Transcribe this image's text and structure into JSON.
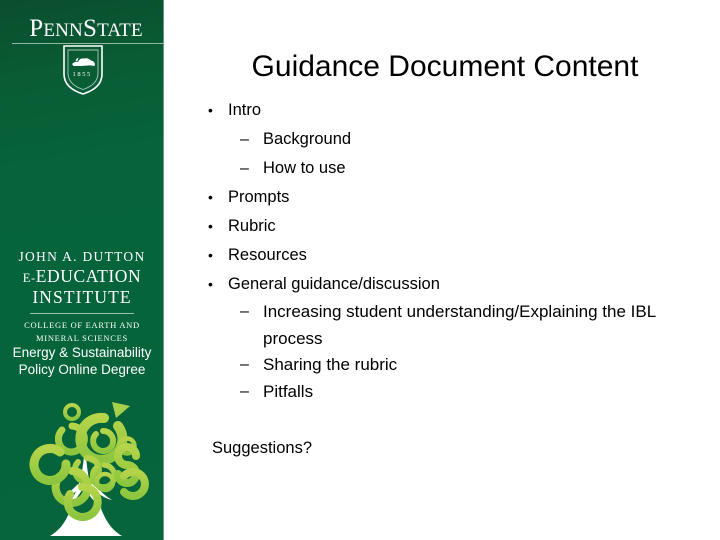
{
  "slide": {
    "title": "Guidance Document Content",
    "closing_text": "Suggestions?",
    "background_color": "#ffffff",
    "text_color": "#000000"
  },
  "sidebar": {
    "background_color": "#06633a",
    "accent_color": "#8dc63f",
    "pennstate_logo": {
      "wordmark_part1": "P",
      "wordmark_part2": "ENN",
      "wordmark_part3": "S",
      "wordmark_part4": "TATE",
      "shield_year": "1855",
      "icon": "pennstate-shield-lion-icon"
    },
    "dutton_logo": {
      "line1": "JOHN A. DUTTON",
      "line2_prefix": "E-",
      "line2": "EDUCATION",
      "line3": "INSTITUTE",
      "sub_line1": "COLLEGE OF EARTH AND",
      "sub_line2": "MINERAL SCIENCES"
    },
    "degree": {
      "line1": "Energy & Sustainability",
      "line2": "Policy Online Degree"
    },
    "tree_graphic": {
      "icon": "escp-letter-tree-icon",
      "letters": [
        "e",
        "c",
        "s",
        "p"
      ]
    }
  },
  "content": {
    "bullets": [
      {
        "level": 1,
        "marker": "•",
        "text": "Intro"
      },
      {
        "level": 2,
        "marker": "–",
        "text": "Background"
      },
      {
        "level": 2,
        "marker": "–",
        "text": "How to use"
      },
      {
        "level": 1,
        "marker": "•",
        "text": "Prompts"
      },
      {
        "level": 1,
        "marker": "•",
        "text": "Rubric"
      },
      {
        "level": 1,
        "marker": "•",
        "text": "Resources"
      },
      {
        "level": 1,
        "marker": "•",
        "text": "General guidance/discussion"
      },
      {
        "level": 2,
        "marker": "–",
        "text": "Increasing student understanding/Explaining the IBL process"
      },
      {
        "level": 2,
        "marker": "–",
        "text": "Sharing the rubric"
      },
      {
        "level": 2,
        "marker": "–",
        "text": "Pitfalls"
      }
    ]
  }
}
